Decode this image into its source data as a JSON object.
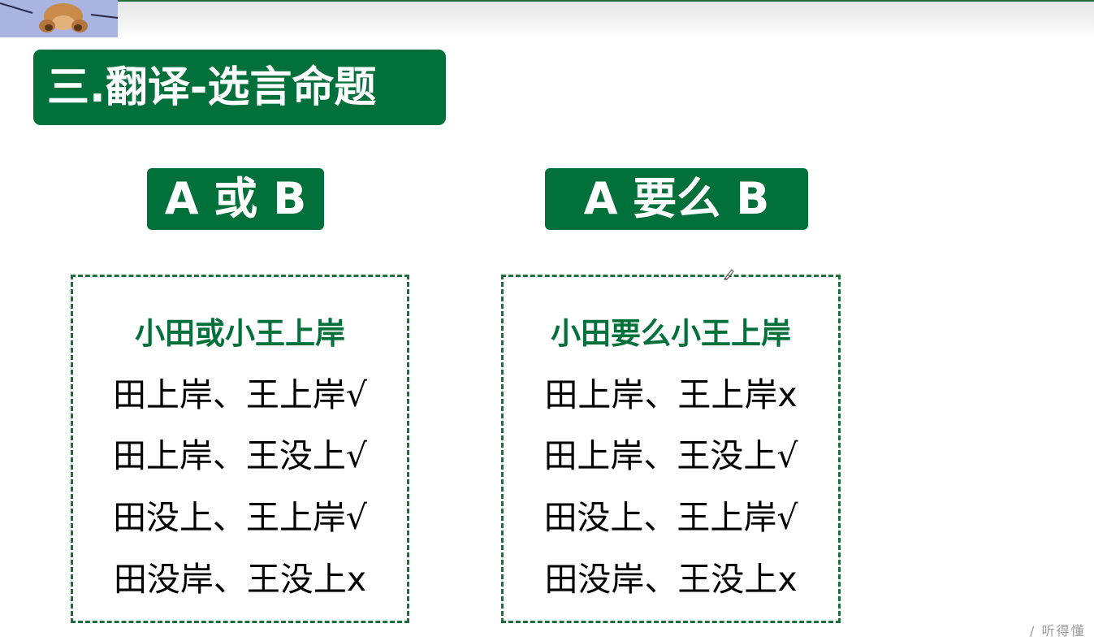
{
  "title": "三.翻译-选言命题",
  "labels": {
    "left": "A 或 B",
    "right": "A 要么 B"
  },
  "panels": {
    "left": {
      "heading": "小田或小王上岸",
      "rows": [
        "田上岸、王上岸√",
        "田上岸、王没上√",
        "田没上、王上岸√",
        "田没岸、王没上x"
      ]
    },
    "right": {
      "heading": "小田要么小王上岸",
      "rows": [
        "田上岸、王上岸x",
        "田上岸、王没上√",
        "田没上、王上岸√",
        "田没岸、王没上x"
      ]
    }
  },
  "watermark": "/ 听得懂",
  "colors": {
    "brand_green": "#02703a",
    "dashed_border": "#1f6f3d",
    "text": "#000000"
  },
  "icons": {
    "avatar": "bear-mascot-icon",
    "cursor": "pen-cursor-icon"
  }
}
